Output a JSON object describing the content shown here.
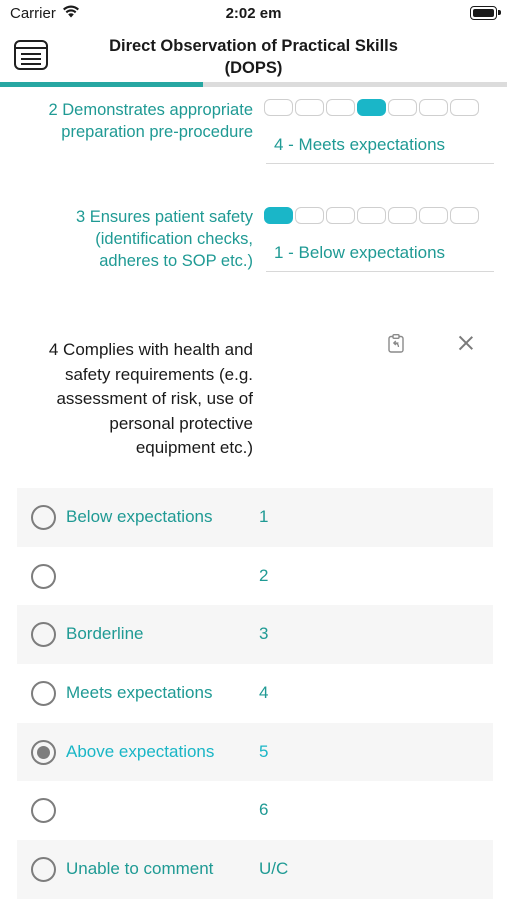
{
  "status_bar": {
    "carrier": "Carrier",
    "time": "2:02 em"
  },
  "nav": {
    "title_line1": "Direct Observation of Practical Skills",
    "title_line2": "(DOPS)"
  },
  "progress": {
    "fraction": 0.4
  },
  "questions": [
    {
      "label_lines": [
        "2 Demonstrates appropriate",
        "preparation pre-procedure"
      ],
      "selected_index": 3,
      "segment_count": 7,
      "value": "4 - Meets expectations"
    },
    {
      "label_lines": [
        "3 Ensures patient safety",
        "(identification checks,",
        "adheres to SOP etc.)"
      ],
      "selected_index": 0,
      "segment_count": 7,
      "value": "1 - Below expectations"
    }
  ],
  "q4": {
    "label_lines": [
      "4 Complies with health and",
      "safety requirements (e.g.",
      "assessment of risk, use of",
      "personal protective",
      "equipment etc.)"
    ],
    "icons": {
      "paste": "clipboard-icon",
      "close": "close-icon"
    }
  },
  "options": [
    {
      "label": "Below expectations",
      "score": "1",
      "selected": false
    },
    {
      "label": "",
      "score": "2",
      "selected": false
    },
    {
      "label": "Borderline",
      "score": "3",
      "selected": false
    },
    {
      "label": "Meets expectations",
      "score": "4",
      "selected": false
    },
    {
      "label": "Above expectations",
      "score": "5",
      "selected": true
    },
    {
      "label": "",
      "score": "6",
      "selected": false
    },
    {
      "label": "Unable to comment",
      "score": "U/C",
      "selected": false
    }
  ],
  "colors": {
    "accent": "#1f9a94",
    "selected_segment": "#1ab6c8",
    "progress": "#27a7a2"
  }
}
